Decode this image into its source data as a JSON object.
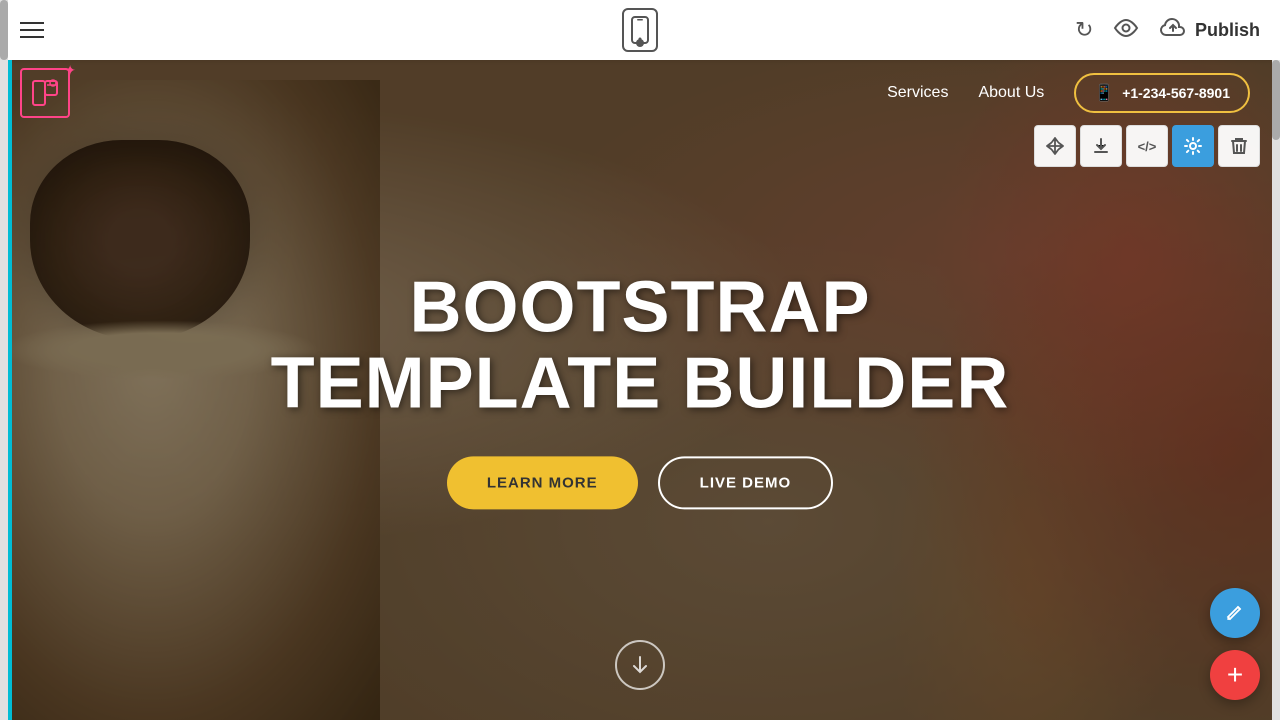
{
  "topbar": {
    "menu_icon_label": "☰",
    "mobile_view_label": "mobile view",
    "undo_label": "↺",
    "preview_label": "👁",
    "publish_label": "Publish",
    "cloud_icon": "☁"
  },
  "site_navbar": {
    "nav_links": [
      {
        "label": "Services"
      },
      {
        "label": "About Us"
      }
    ],
    "phone": "+1-234-567-8901",
    "logo_icon": "⊞"
  },
  "hero": {
    "title_line1": "BOOTSTRAP",
    "title_line2": "TEMPLATE BUILDER",
    "btn_learn_more": "LEARN MORE",
    "btn_live_demo": "LIVE DEMO",
    "scroll_down": "↓"
  },
  "section_toolbar": {
    "move_icon": "↕",
    "download_icon": "↓",
    "code_icon": "</>",
    "settings_icon": "⚙",
    "delete_icon": "🗑"
  },
  "fabs": {
    "edit_icon": "✏",
    "add_icon": "+"
  },
  "colors": {
    "accent_yellow": "#f0c030",
    "accent_blue": "#3b9ede",
    "accent_red": "#f04040",
    "accent_teal": "#00bcd4",
    "logo_pink": "#ff4488"
  }
}
